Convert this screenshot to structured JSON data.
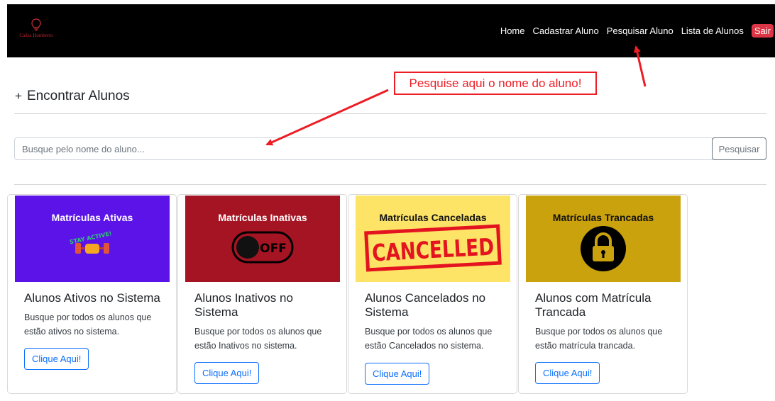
{
  "navbar": {
    "logo_text": "Cadas Humberto",
    "links": [
      "Home",
      "Cadastrar Aluno",
      "Pesquisar Aluno",
      "Lista de Alunos"
    ],
    "logout": "Sair",
    "background": "#000000"
  },
  "section": {
    "plus": "+",
    "title": "Encontrar Alunos"
  },
  "search": {
    "placeholder": "Busque pelo nome do aluno...",
    "button": "Pesquisar"
  },
  "annotation": {
    "text": "Pesquise aqui o nome do aluno!",
    "color": "#ee1c24"
  },
  "cards": [
    {
      "image_title": "Matrículas Ativas",
      "image_bg": "#5b13e8",
      "image_label": "STAY ACTIVE!",
      "icon": "stay-active-dumbbell-icon",
      "title": "Alunos Ativos no Sistema",
      "text": "Busque por todos os alunos que estão ativos no sistema.",
      "button": "Clique Aqui!"
    },
    {
      "image_title": "Matrículas Inativas",
      "image_bg": "#a51423",
      "image_label": "OFF",
      "icon": "toggle-off-icon",
      "title": "Alunos Inativos no Sistema",
      "text": "Busque por todos os alunos que estão Inativos no sistema.",
      "button": "Clique Aqui!"
    },
    {
      "image_title": "Matrículas Canceladas",
      "image_bg": "#fde366",
      "image_label": "CANCELLED",
      "icon": "cancelled-stamp-icon",
      "title": "Alunos Cancelados no Sistema",
      "text": "Busque por todos os alunos que estão Cancelados no sistema.",
      "button": "Clique Aqui!"
    },
    {
      "image_title": "Matrículas Trancadas",
      "image_bg": "#c9a20d",
      "icon": "padlock-icon",
      "title": "Alunos com Matrícula Trancada",
      "text": "Busque por todos os alunos que estão matrícula trancada.",
      "button": "Clique Aqui!"
    }
  ]
}
